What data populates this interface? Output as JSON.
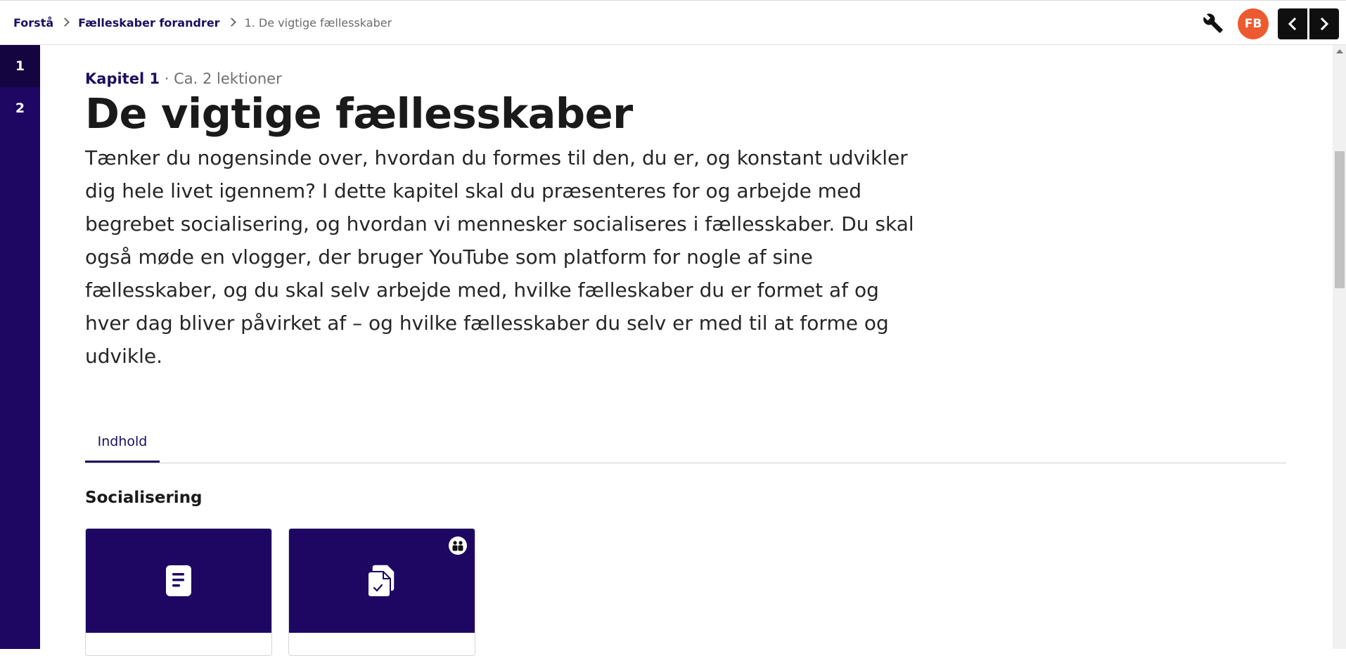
{
  "breadcrumb": {
    "items": [
      "Forstå",
      "Fælleskaber forandrer"
    ],
    "current": "1. De vigtige fællesskaber"
  },
  "header": {
    "tool_icon": "wrench-icon",
    "avatar_initials": "FB",
    "prev_icon": "chevron-left-icon",
    "next_icon": "chevron-right-icon"
  },
  "sidebar": {
    "items": [
      {
        "label": "1",
        "active": true
      },
      {
        "label": "2",
        "active": false
      }
    ]
  },
  "chapter": {
    "label": "Kapitel 1",
    "duration": " · Ca. 2 lektioner",
    "title": "De vigtige fællesskaber",
    "intro": "Tænker du nogensinde over, hvordan du formes til den, du er, og konstant udvikler dig hele livet igennem? I dette kapitel skal du præsenteres for og arbejde med begrebet socialisering, og hvordan vi mennesker socialiseres i fællesskaber. Du skal også møde en vlogger, der bruger YouTube som platform for nogle af sine fællesskaber, og du skal selv arbejde med, hvilke fælleskaber du er formet af og hver dag bliver påvirket af – og hvilke fællesskaber du selv er med til at forme og udvikle."
  },
  "tabs": [
    {
      "label": "Indhold",
      "active": true
    }
  ],
  "section": {
    "title": "Socialisering",
    "cards": [
      {
        "icon": "document-icon",
        "badge": null
      },
      {
        "icon": "assignment-icon",
        "badge": "group-icon"
      }
    ]
  },
  "colors": {
    "brand": "#1e0763",
    "link": "#1e0e5f",
    "avatar": "#ee5a2f"
  }
}
